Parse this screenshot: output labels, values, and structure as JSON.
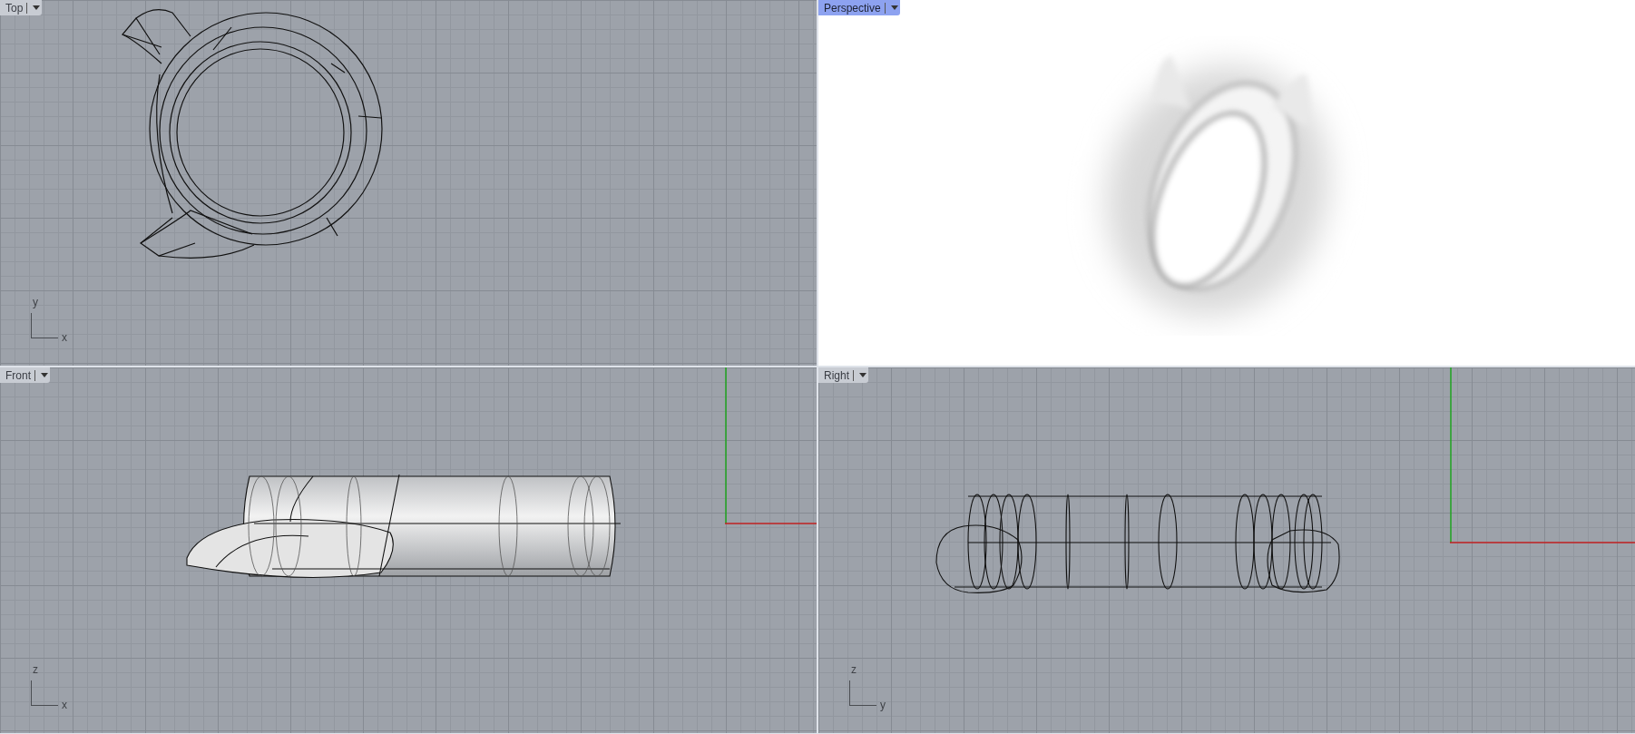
{
  "viewports": [
    {
      "title": "Top",
      "selected": false,
      "kind": "top",
      "axes": {
        "vertical": "y",
        "horizontal": "x"
      }
    },
    {
      "title": "Perspective",
      "selected": true,
      "kind": "perspective"
    },
    {
      "title": "Front",
      "selected": false,
      "kind": "front",
      "axes": {
        "vertical": "z",
        "horizontal": "x"
      }
    },
    {
      "title": "Right",
      "selected": false,
      "kind": "right",
      "axes": {
        "vertical": "z",
        "horizontal": "y"
      }
    }
  ]
}
